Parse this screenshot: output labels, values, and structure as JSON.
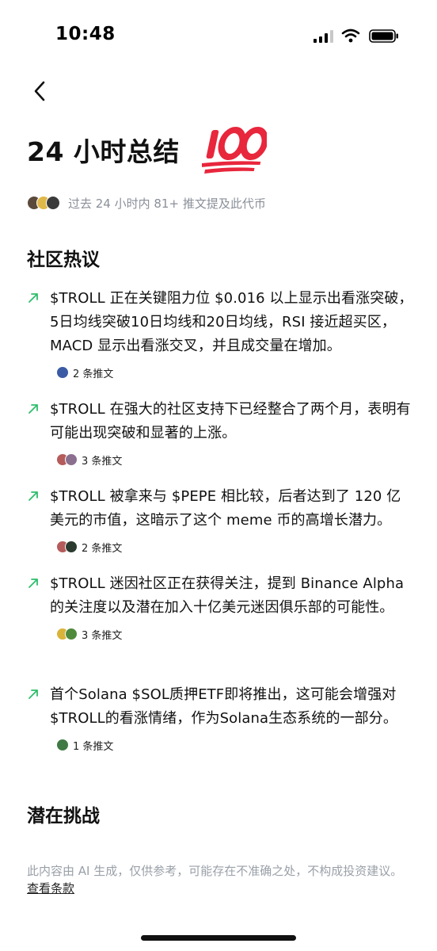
{
  "status_bar": {
    "time": "10:48"
  },
  "header": {
    "title": "24 小时总结"
  },
  "mentions": {
    "text": "过去 24 小时内 81+ 推文提及此代币"
  },
  "sections": {
    "community": "社区热议",
    "challenges": "潜在挑战"
  },
  "items": [
    {
      "text": "$TROLL 正在关键阻力位 $0.016 以上显示出看涨突破，5日均线突破10日均线和20日均线，RSI 接近超买区，MACD 显示出看涨交叉，并且成交量在增加。",
      "meta": "2 条推文"
    },
    {
      "text": "$TROLL 在强大的社区支持下已经整合了两个月，表明有可能出现突破和显著的上涨。",
      "meta": "3 条推文"
    },
    {
      "text": "$TROLL 被拿来与 $PEPE 相比较，后者达到了 120 亿美元的市值，这暗示了这个 meme 币的高增长潜力。",
      "meta": "2 条推文"
    },
    {
      "text": "$TROLL 迷因社区正在获得关注，提到 Binance Alpha 的关注度以及潜在加入十亿美元迷因俱乐部的可能性。",
      "meta": "3 条推文"
    },
    {
      "text": "首个Solana $SOL质押ETF即将推出，这可能会增强对$TROLL的看涨情绪，作为Solana生态系统的一部分。",
      "meta": "1 条推文"
    }
  ],
  "footer": {
    "disclaimer": "此内容由 AI 生成，仅供参考，可能存在不准确之处，不构成投资建议。",
    "terms_link": "查看条款"
  },
  "colors": {
    "accent_green": "#2ebd6b",
    "muted_text": "#8a8f99",
    "emoji_red": "#e8263c"
  },
  "icons": [
    "back-chevron-icon",
    "hundred-points-icon",
    "trend-up-arrow-icon",
    "signal-icon",
    "wifi-icon",
    "battery-icon"
  ]
}
